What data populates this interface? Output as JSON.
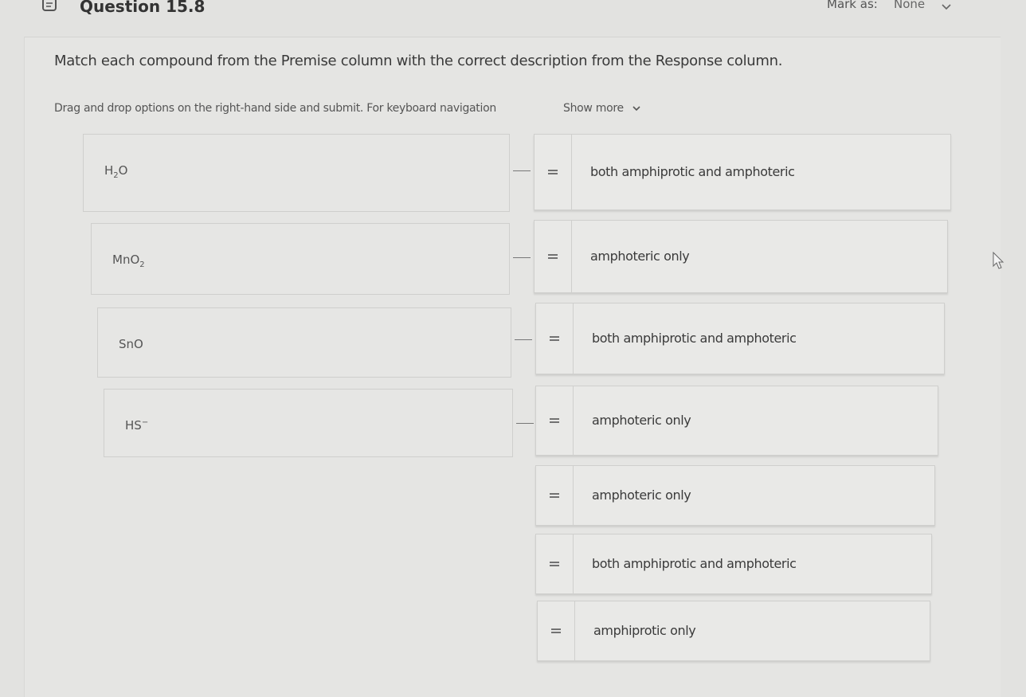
{
  "header": {
    "question_title": "Question 15.8",
    "mark_as_label": "Mark as:",
    "mark_as_value": "None"
  },
  "instructions": {
    "main": "Match each compound from the Premise column with the correct description from the Response column.",
    "hint": "Drag and drop options on the right-hand side and submit. For keyboard navigation",
    "show_more": "Show more"
  },
  "premises": [
    {
      "base": "H",
      "sub": "2",
      "tail": "O",
      "sup": ""
    },
    {
      "base": "MnO",
      "sub": "2",
      "tail": "",
      "sup": ""
    },
    {
      "base": "SnO",
      "sub": "",
      "tail": "",
      "sup": ""
    },
    {
      "base": "HS",
      "sub": "",
      "tail": "",
      "sup": "−"
    }
  ],
  "responses": [
    "both amphiprotic and amphoteric",
    "amphoteric only",
    "both amphiprotic and amphoteric",
    "amphoteric only",
    "amphoteric only",
    "both amphiprotic and amphoteric",
    "amphiprotic only"
  ],
  "icons": {
    "question": "question-icon",
    "chevron": "chevron-down-icon",
    "drag_handle": "drag-handle-icon",
    "cursor": "mouse-cursor-icon"
  }
}
